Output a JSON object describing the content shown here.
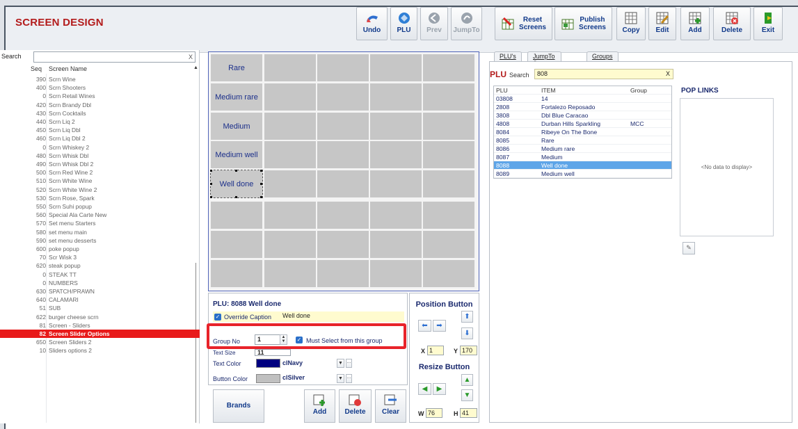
{
  "app": {
    "title": "SCREEN DESIGN"
  },
  "toolbar": [
    {
      "label": "Undo",
      "icon": "undo-icon"
    },
    {
      "label": "PLU",
      "icon": "plu-icon"
    },
    {
      "label": "Prev",
      "icon": "prev-icon"
    },
    {
      "label": "JumpTo",
      "icon": "jumpto-icon"
    },
    {
      "label": "Reset\nScreens",
      "icon": "reset-screens-icon"
    },
    {
      "label": "Publish\nScreens",
      "icon": "publish-screens-icon"
    },
    {
      "label": "Copy",
      "icon": "copy-icon"
    },
    {
      "label": "Edit",
      "icon": "edit-icon"
    },
    {
      "label": "Add",
      "icon": "add-icon"
    },
    {
      "label": "Delete",
      "icon": "delete-icon"
    },
    {
      "label": "Exit",
      "icon": "exit-icon"
    }
  ],
  "left": {
    "search_label": "Search",
    "search_value": "",
    "clear": "X",
    "head_seq": "Seq",
    "head_name": "Screen Name",
    "rows": [
      {
        "seq": "390",
        "name": "Scrn Wine"
      },
      {
        "seq": "400",
        "name": "Scrn Shooters"
      },
      {
        "seq": "0",
        "name": "Scrn Retail Wines"
      },
      {
        "seq": "420",
        "name": "Scrn Brandy Dbl"
      },
      {
        "seq": "430",
        "name": "Scrn Cocktails"
      },
      {
        "seq": "440",
        "name": "Scrn Liq 2"
      },
      {
        "seq": "450",
        "name": "Scrn Liq Dbl"
      },
      {
        "seq": "460",
        "name": "Scrn Liq Dbl 2"
      },
      {
        "seq": "0",
        "name": "Scrn Whiskey 2"
      },
      {
        "seq": "480",
        "name": "Scrn Whisk Dbl"
      },
      {
        "seq": "490",
        "name": "Scrn Whisk Dbl 2"
      },
      {
        "seq": "500",
        "name": "Scrn Red Wine 2"
      },
      {
        "seq": "510",
        "name": "Scrn White Wine"
      },
      {
        "seq": "520",
        "name": "Scrn White Wine 2"
      },
      {
        "seq": "530",
        "name": "Scrn Rose, Spark"
      },
      {
        "seq": "550",
        "name": "Scrn Suhi popup"
      },
      {
        "seq": "560",
        "name": "Special Ala Carte New"
      },
      {
        "seq": "570",
        "name": "Set menu Starters"
      },
      {
        "seq": "580",
        "name": "set menu main"
      },
      {
        "seq": "590",
        "name": "set menu desserts"
      },
      {
        "seq": "600",
        "name": "poke popup"
      },
      {
        "seq": "70",
        "name": "Scr Wisk 3"
      },
      {
        "seq": "620",
        "name": "steak popup"
      },
      {
        "seq": "0",
        "name": "STEAK TT"
      },
      {
        "seq": "0",
        "name": "NUMBERS"
      },
      {
        "seq": "630",
        "name": "SPATCH/PRAWN"
      },
      {
        "seq": "640",
        "name": "CALAMARI"
      },
      {
        "seq": "51",
        "name": "SUB"
      },
      {
        "seq": "622",
        "name": "burger cheese scrn"
      },
      {
        "seq": "81",
        "name": "Screen - Sliders"
      },
      {
        "seq": "82",
        "name": "Screen Slider Options",
        "selected": true
      },
      {
        "seq": "650",
        "name": "Screen Sliders 2"
      },
      {
        "seq": "10",
        "name": "Sliders options 2"
      }
    ]
  },
  "grid": {
    "buttons": [
      "Rare",
      "Medium rare",
      "Medium",
      "Medium well",
      "Well done"
    ]
  },
  "props": {
    "plu_title": "PLU: 8088 Well done",
    "override_label": "Override Caption",
    "override_value": "Well done",
    "group_label": "Group No",
    "group_value": "1",
    "must_select": "Must Select from this group",
    "textsize_label": "Text Size",
    "textsize_value": "11",
    "textcolor_label": "Text Color",
    "textcolor_value": "clNavy",
    "textcolor_hex": "#000080",
    "buttoncolor_label": "Button Color",
    "buttoncolor_value": "clSilver",
    "buttoncolor_hex": "#c0c0c0"
  },
  "position": {
    "title": "Position Button",
    "x_label": "X",
    "x_value": "1",
    "y_label": "Y",
    "y_value": "170",
    "resize_title": "Resize Button",
    "w_label": "W",
    "w_value": "76",
    "h_label": "H",
    "h_value": "41"
  },
  "bottom_buttons": {
    "brands": "Brands",
    "add": "Add",
    "delete": "Delete",
    "clear": "Clear"
  },
  "right": {
    "tabs": [
      "PLU's",
      "JumpTo Screens",
      "Groups"
    ],
    "plu_title": "PLU",
    "search_label": "Search",
    "search_value": "808",
    "clear": "X",
    "columns": [
      "PLU",
      "ITEM",
      "Group"
    ],
    "rows": [
      {
        "plu": "03808",
        "item": "14",
        "group": ""
      },
      {
        "plu": "2808",
        "item": "Fortalezo Reposado",
        "group": ""
      },
      {
        "plu": "3808",
        "item": "Dbl Blue Caracao",
        "group": ""
      },
      {
        "plu": "4808",
        "item": "Durban Hills Sparkling",
        "group": "MCC"
      },
      {
        "plu": "8084",
        "item": "Ribeye On The Bone",
        "group": ""
      },
      {
        "plu": "8085",
        "item": "Rare",
        "group": ""
      },
      {
        "plu": "8086",
        "item": "Medium rare",
        "group": ""
      },
      {
        "plu": "8087",
        "item": "Medium",
        "group": ""
      },
      {
        "plu": "8088",
        "item": "Well done",
        "group": "",
        "selected": true
      },
      {
        "plu": "8089",
        "item": "Medium well",
        "group": ""
      }
    ],
    "pop_title": "POP LINKS",
    "pop_empty": "<No data to display>"
  }
}
